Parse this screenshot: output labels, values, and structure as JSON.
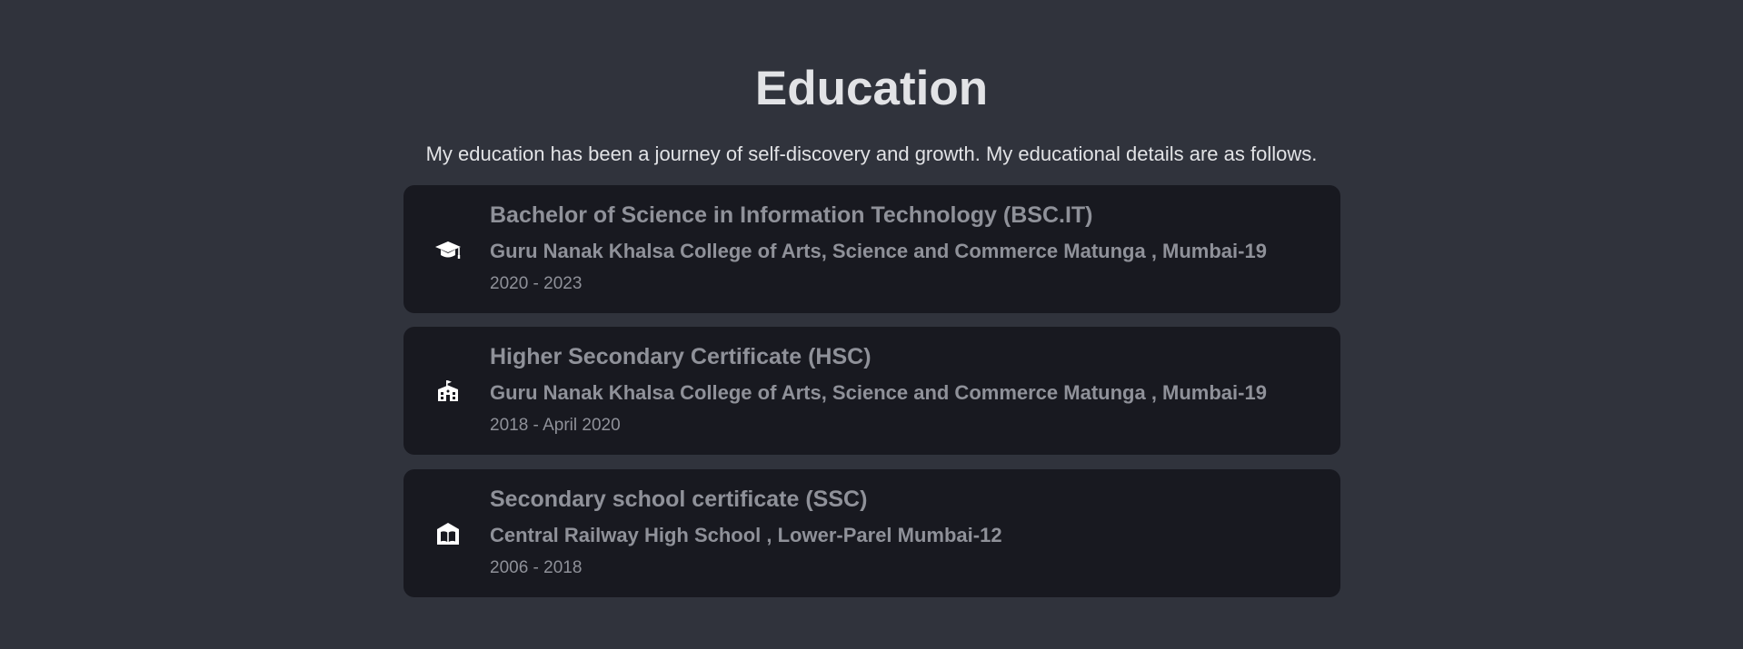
{
  "section": {
    "title": "Education",
    "subtitle": "My education has been a journey of self-discovery and growth. My educational details are as follows."
  },
  "entries": [
    {
      "icon": "graduation-cap-icon",
      "degree": "Bachelor of Science in Information Technology (BSC.IT)",
      "school": "Guru Nanak Khalsa College of Arts, Science and Commerce Matunga , Mumbai-19",
      "years": "2020 - 2023"
    },
    {
      "icon": "school-building-icon",
      "degree": "Higher Secondary Certificate (HSC)",
      "school": "Guru Nanak Khalsa College of Arts, Science and Commerce Matunga , Mumbai-19",
      "years": "2018 - April 2020"
    },
    {
      "icon": "book-school-icon",
      "degree": "Secondary school certificate (SSC)",
      "school": "Central Railway High School , Lower-Parel Mumbai-12",
      "years": "2006 - 2018"
    }
  ],
  "colors": {
    "background": "#30333c",
    "card": "#181920",
    "heading": "#e2e3e6",
    "muted": "#8f9199"
  }
}
